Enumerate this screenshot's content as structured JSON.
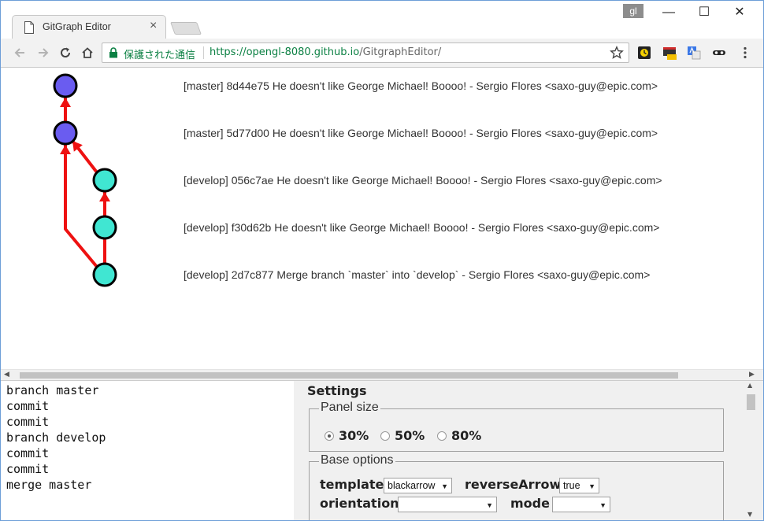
{
  "browser": {
    "tab_title": "GitGraph Editor",
    "close_glyph": "×",
    "user_badge": "gl",
    "window_controls": {
      "minimize": "—",
      "maximize": "☐",
      "close": "✕"
    },
    "secure_label": "保護された通信",
    "url_host": "https://opengl-8080.github.io",
    "url_path": "/GitgraphEditor/"
  },
  "graph": {
    "colors": {
      "master": "#6a5cf0",
      "develop": "#40e6d2",
      "arrow": "#ee1111"
    },
    "commits": [
      {
        "branch": "master",
        "message": "[master] 8d44e75 He doesn't like George Michael! Boooo! - Sergio Flores <saxo-guy@epic.com>"
      },
      {
        "branch": "master",
        "message": "[master] 5d77d00 He doesn't like George Michael! Boooo! - Sergio Flores <saxo-guy@epic.com>"
      },
      {
        "branch": "develop",
        "message": "[develop] 056c7ae He doesn't like George Michael! Boooo! - Sergio Flores <saxo-guy@epic.com>"
      },
      {
        "branch": "develop",
        "message": "[develop] f30d62b He doesn't like George Michael! Boooo! - Sergio Flores <saxo-guy@epic.com>"
      },
      {
        "branch": "develop",
        "message": "[develop] 2d7c877 Merge branch `master` into `develop` - Sergio Flores <saxo-guy@epic.com>"
      }
    ]
  },
  "editor": {
    "lines": [
      "branch master",
      "commit",
      "commit",
      "branch develop",
      "commit",
      "commit",
      "merge master"
    ]
  },
  "settings": {
    "title": "Settings",
    "panel_size": {
      "legend": "Panel size",
      "options": [
        "30%",
        "50%",
        "80%"
      ],
      "selected": "30%"
    },
    "base_options": {
      "legend": "Base options",
      "template_label": "template",
      "template_value": "blackarrow",
      "reverse_arrow_label": "reverseArrow",
      "reverse_arrow_value": "true",
      "orientation_label": "orientation",
      "orientation_value": "",
      "mode_label": "mode",
      "mode_value": ""
    }
  }
}
